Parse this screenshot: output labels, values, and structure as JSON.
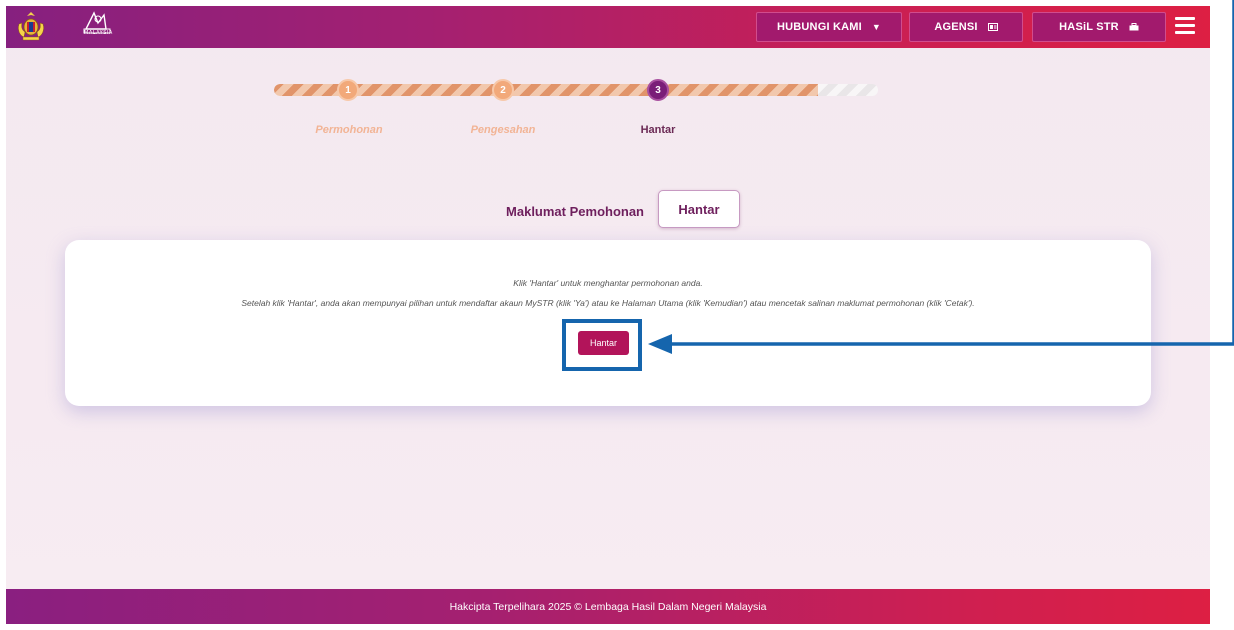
{
  "header": {
    "nav": [
      {
        "label": "HUBUNGI KAMI",
        "icon": "caret-down-icon"
      },
      {
        "label": "AGENSI",
        "icon": "id-card-icon"
      },
      {
        "label": "HASiL STR",
        "icon": "briefcase-icon"
      }
    ],
    "menu_icon": "hamburger-icon",
    "logos": {
      "lhdn_text": "MALAYSIA"
    }
  },
  "stepper": {
    "progress": 0.9,
    "steps": [
      {
        "number": "1",
        "label": "Permohonan",
        "state": "done"
      },
      {
        "number": "2",
        "label": "Pengesahan",
        "state": "done"
      },
      {
        "number": "3",
        "label": "Hantar",
        "state": "active"
      }
    ]
  },
  "tabs": {
    "maklumat": "Maklumat Pemohonan",
    "hantar": "Hantar"
  },
  "card": {
    "line1": "Klik 'Hantar' untuk menghantar permohonan anda.",
    "line2": "Setelah klik 'Hantar', anda akan mempunyai pilihan untuk mendaftar akaun MySTR (klik 'Ya') atau ke Halaman Utama (klik 'Kemudian') atau mencetak salinan maklumat permohonan (klik 'Cetak').",
    "submit_label": "Hantar"
  },
  "footer": {
    "text": "Hakcipta Terpelihara 2025 © Lembaga Hasil Dalam Negeri Malaysia"
  },
  "colors": {
    "header_start": "#86207f",
    "header_end": "#dd1f43",
    "submit_button": "#b2145a",
    "annotation": "#1565ad",
    "step_done": "#f2a97a",
    "step_active": "#7a1e78"
  }
}
